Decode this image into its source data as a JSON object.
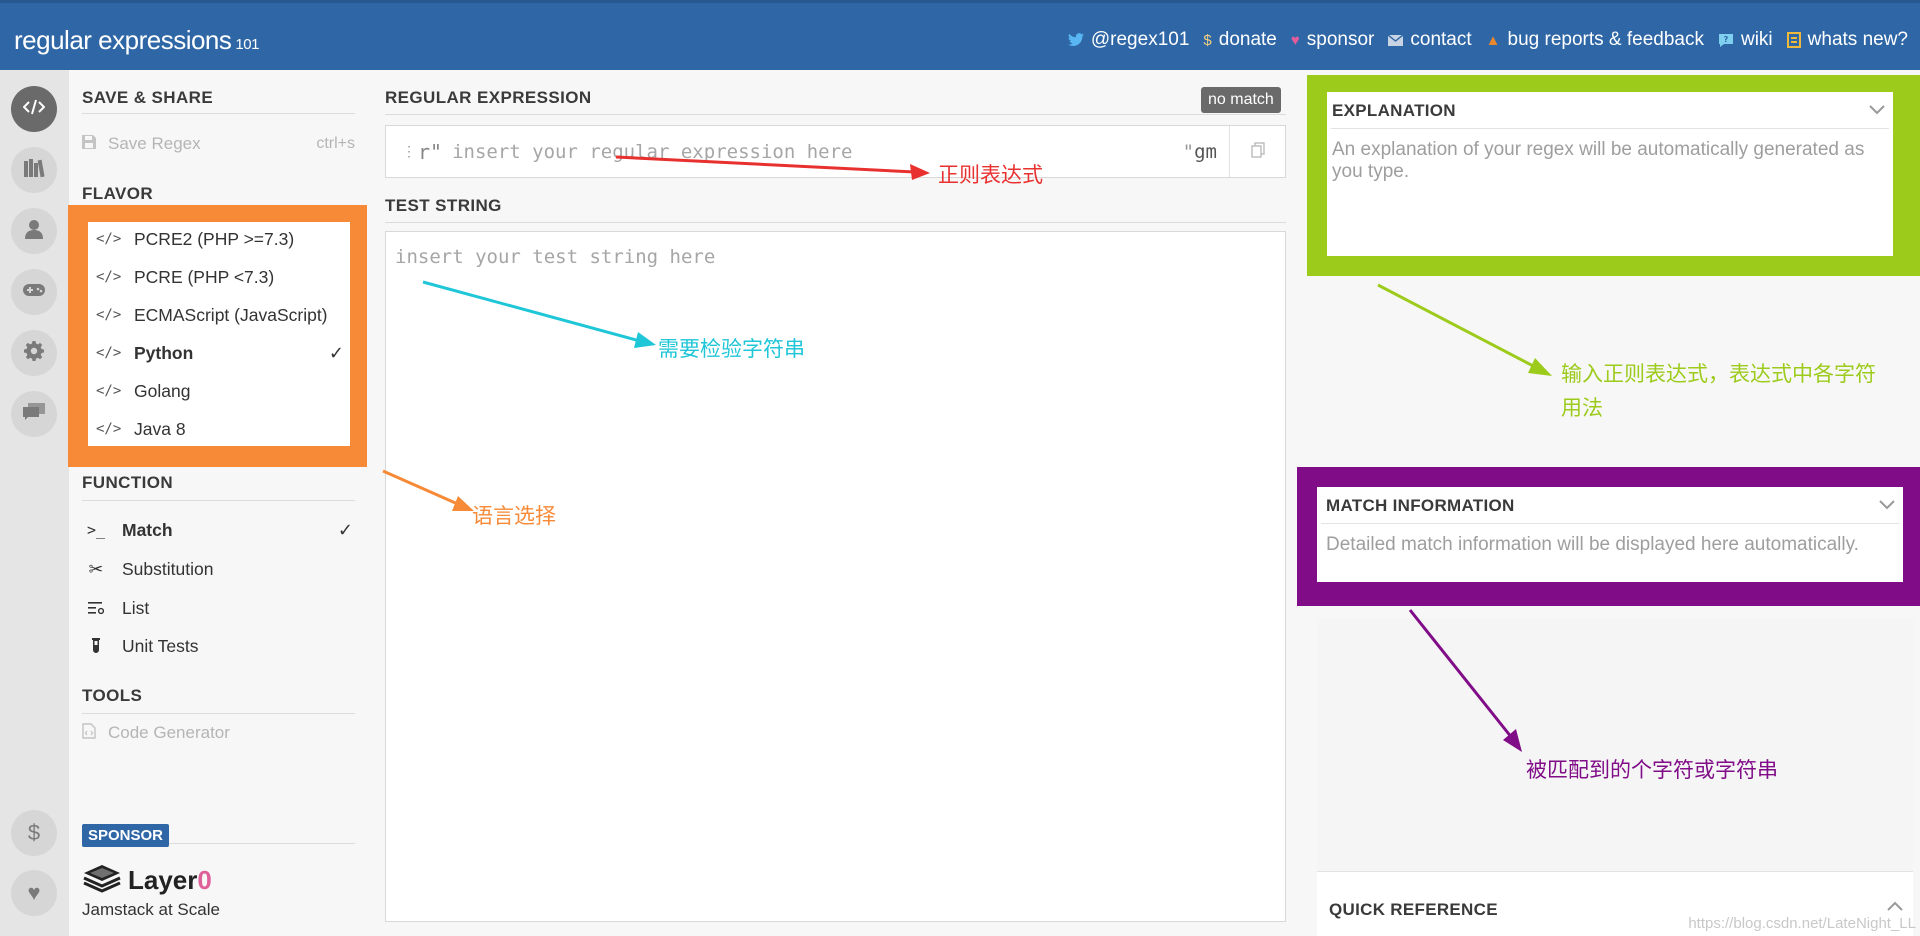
{
  "brand": {
    "name": "regular expressions",
    "version": "101"
  },
  "topnav": [
    {
      "icon": "twitter-icon",
      "label": "@regex101"
    },
    {
      "icon": "dollar-icon",
      "label": "donate"
    },
    {
      "icon": "heart-icon",
      "label": "sponsor"
    },
    {
      "icon": "mail-icon",
      "label": "contact"
    },
    {
      "icon": "warning-icon",
      "label": "bug reports & feedback"
    },
    {
      "icon": "wiki-icon",
      "label": "wiki"
    },
    {
      "icon": "news-icon",
      "label": "whats new?"
    }
  ],
  "rail": [
    "code-icon",
    "library-icon",
    "user-icon",
    "gamepad-icon",
    "gear-icon",
    "chat-icon",
    "dollar-icon",
    "heart-icon"
  ],
  "left": {
    "save_share_title": "SAVE & SHARE",
    "save_label": "Save Regex",
    "save_shortcut": "ctrl+s",
    "flavor_title": "FLAVOR",
    "flavors": [
      "PCRE2 (PHP >=7.3)",
      "PCRE (PHP <7.3)",
      "ECMAScript (JavaScript)",
      "Python",
      "Golang",
      "Java 8"
    ],
    "selected_flavor": "Python",
    "function_title": "FUNCTION",
    "functions": [
      "Match",
      "Substitution",
      "List",
      "Unit Tests"
    ],
    "selected_function": "Match",
    "tools_title": "TOOLS",
    "code_generator": "Code Generator",
    "sponsor_badge": "SPONSOR",
    "sponsor_name": "Layer",
    "sponsor_name_zero": "0",
    "sponsor_tagline": "Jamstack at Scale"
  },
  "middle": {
    "regex_title": "REGULAR EXPRESSION",
    "match_status": "no match",
    "regex_prefix": "r\"",
    "regex_placeholder": "insert your regular expression here",
    "regex_suffix": "\"",
    "regex_flags": "gm",
    "test_title": "TEST STRING",
    "test_placeholder": "insert your test string here"
  },
  "right": {
    "explanation_title": "EXPLANATION",
    "explanation_text": "An explanation of your regex will be automatically generated as you type.",
    "match_info_title": "MATCH INFORMATION",
    "match_info_text": "Detailed match information will be displayed here automatically.",
    "quick_ref_title": "QUICK REFERENCE",
    "watermark": "https://blog.csdn.net/LateNight_LL"
  },
  "annotations": {
    "regex": "正则表达式",
    "test_string": "需要检验字符串",
    "language": "语言选择",
    "explanation_line1": "输入正则表达式，表达式中各字符",
    "explanation_line2": "用法",
    "match": "被匹配到的个字符或字符串"
  },
  "colors": {
    "header": "#2e66a6",
    "flavor_highlight": "#f68a37",
    "explanation_highlight": "#9ccb1c",
    "match_highlight": "#800c88",
    "regex_arrow": "#e8312f",
    "test_arrow": "#1fc6d8"
  }
}
